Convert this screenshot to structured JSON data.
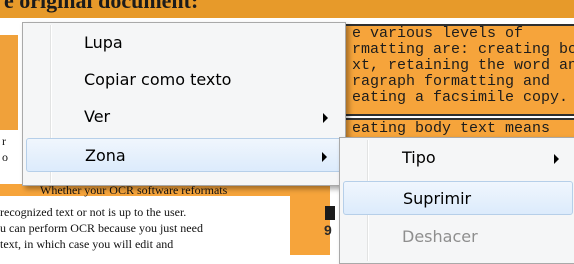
{
  "document": {
    "heading": "e original document:",
    "right_block_lines": [
      "e various levels of",
      "rmatting are: creating bo",
      "xt, retaining the word an",
      "ragraph formatting and",
      "eating a facsimile copy."
    ],
    "right_block2_line": "eating body text means",
    "left_lines": [
      "Whether your OCR software reformats",
      "recognized text or not is up to the user.",
      "u can perform OCR because you just need",
      "text, in which case you will edit and"
    ],
    "left_fragments": [
      "r",
      "o"
    ],
    "mid_glyph": "9"
  },
  "context_menu": {
    "items": [
      {
        "label": "Lupa",
        "has_submenu": false,
        "highlighted": false
      },
      {
        "label": "Copiar como texto",
        "has_submenu": false,
        "highlighted": false
      },
      {
        "label": "Ver",
        "has_submenu": true,
        "highlighted": false
      },
      {
        "label": "Zona",
        "has_submenu": true,
        "highlighted": true
      }
    ]
  },
  "submenu": {
    "items": [
      {
        "label": "Tipo",
        "has_submenu": true,
        "highlighted": false,
        "enabled": true
      },
      {
        "label": "Suprimir",
        "has_submenu": false,
        "highlighted": true,
        "enabled": true
      },
      {
        "label": "Deshacer",
        "has_submenu": false,
        "highlighted": false,
        "enabled": false
      }
    ]
  },
  "colors": {
    "document_highlight": "#f6a43b",
    "menu_background": "#f5f6f7",
    "menu_hover": "#dcebfc",
    "disabled_text": "#8e8e8e"
  }
}
